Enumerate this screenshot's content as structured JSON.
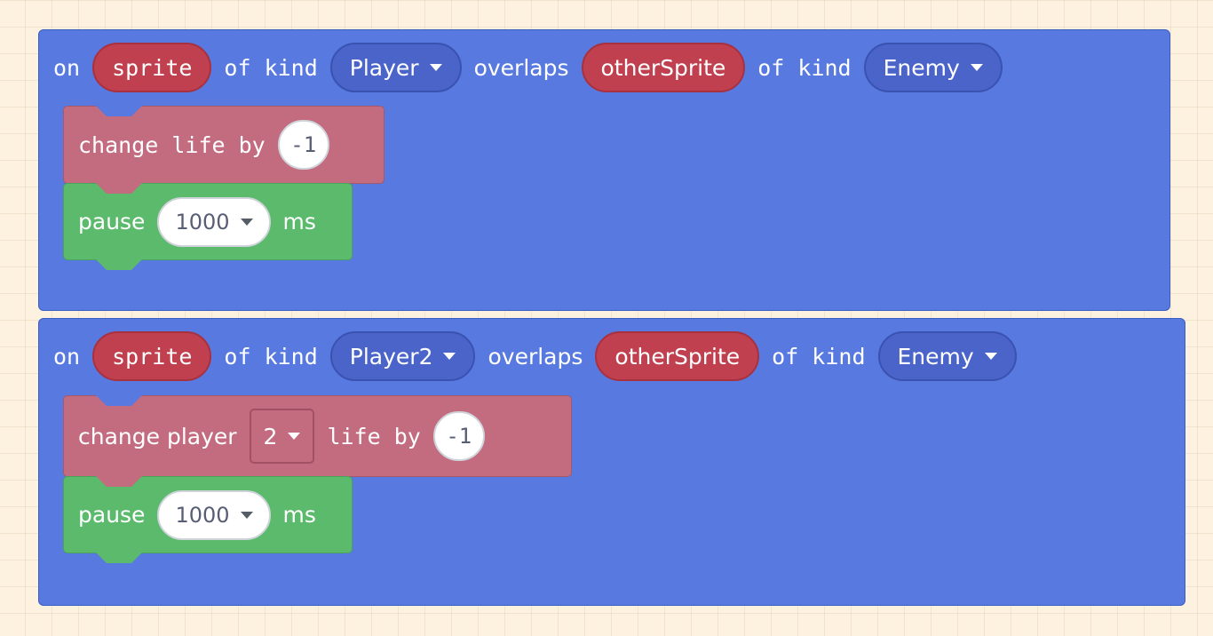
{
  "blocks": [
    {
      "header": {
        "on": "on",
        "sprite_var": "sprite",
        "of_kind_1": "of kind",
        "kind_1": "Player",
        "overlaps": "overlaps",
        "other_var": "otherSprite",
        "of_kind_2": "of kind",
        "kind_2": "Enemy"
      },
      "life_stmt": {
        "text": "change life by",
        "value": "-1"
      },
      "pause_stmt": {
        "text": "pause",
        "value": "1000",
        "unit": "ms"
      }
    },
    {
      "header": {
        "on": "on",
        "sprite_var": "sprite",
        "of_kind_1": "of kind",
        "kind_1": "Player2",
        "overlaps": "overlaps",
        "other_var": "otherSprite",
        "of_kind_2": "of kind",
        "kind_2": "Enemy"
      },
      "life_stmt": {
        "prefix": "change player",
        "player": "2",
        "suffix": "life by",
        "value": "-1"
      },
      "pause_stmt": {
        "text": "pause",
        "value": "1000",
        "unit": "ms"
      }
    }
  ],
  "colors": {
    "event": "#5779e0",
    "variable": "#c0404f",
    "kind": "#4a64c9",
    "info": "#c36b7f",
    "loops": "#5cba6d",
    "workspace": "#fdf1df"
  }
}
